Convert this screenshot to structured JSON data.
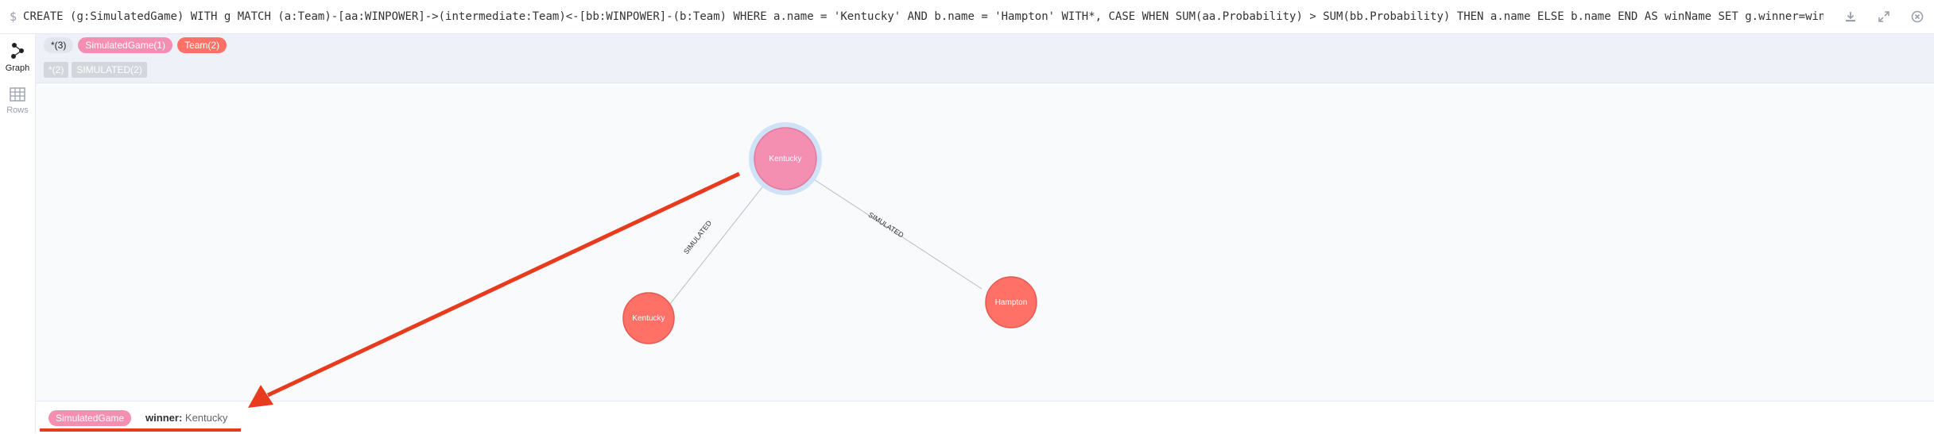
{
  "query": {
    "prompt": "$",
    "text": "CREATE (g:SimulatedGame) WITH g MATCH (a:Team)-[aa:WINPOWER]->(intermediate:Team)<-[bb:WINPOWER]-(b:Team) WHERE a.name = 'Kentucky' AND b.name = 'Hampton' WITH*, CASE WHEN SUM(aa.Probability) > SUM(bb.Probability) THEN a.name ELSE b.name END AS winName SET g.winner=winName WITH* MERGE (a)-[:SIMULATED]->(g)<-[..."
  },
  "top_actions": [
    "download-icon",
    "expand-icon",
    "close-icon"
  ],
  "sidebar": {
    "items": [
      {
        "label": "Graph",
        "icon": "graph-icon",
        "active": true
      },
      {
        "label": "Rows",
        "icon": "table-icon",
        "active": false
      }
    ]
  },
  "labels": {
    "all": "*(3)",
    "simulated_game": "SimulatedGame(1)",
    "team": "Team(2)"
  },
  "relationships": {
    "all": "*(2)",
    "simulated": "SIMULATED(2)"
  },
  "graph": {
    "nodes": [
      {
        "label": "Kentucky",
        "type": "SimulatedGame",
        "selected": true
      },
      {
        "label": "Kentucky",
        "type": "Team"
      },
      {
        "label": "Hampton",
        "type": "Team"
      }
    ],
    "edges": [
      {
        "label": "SIMULATED"
      },
      {
        "label": "SIMULATED"
      }
    ]
  },
  "inspector": {
    "label": "SimulatedGame",
    "key": "winner:",
    "value": "Kentucky"
  },
  "colors": {
    "simulated_game": "#f48fb1",
    "team": "#ff7067",
    "annotation": "#e83b1e",
    "selection": "#b7d4f0"
  }
}
